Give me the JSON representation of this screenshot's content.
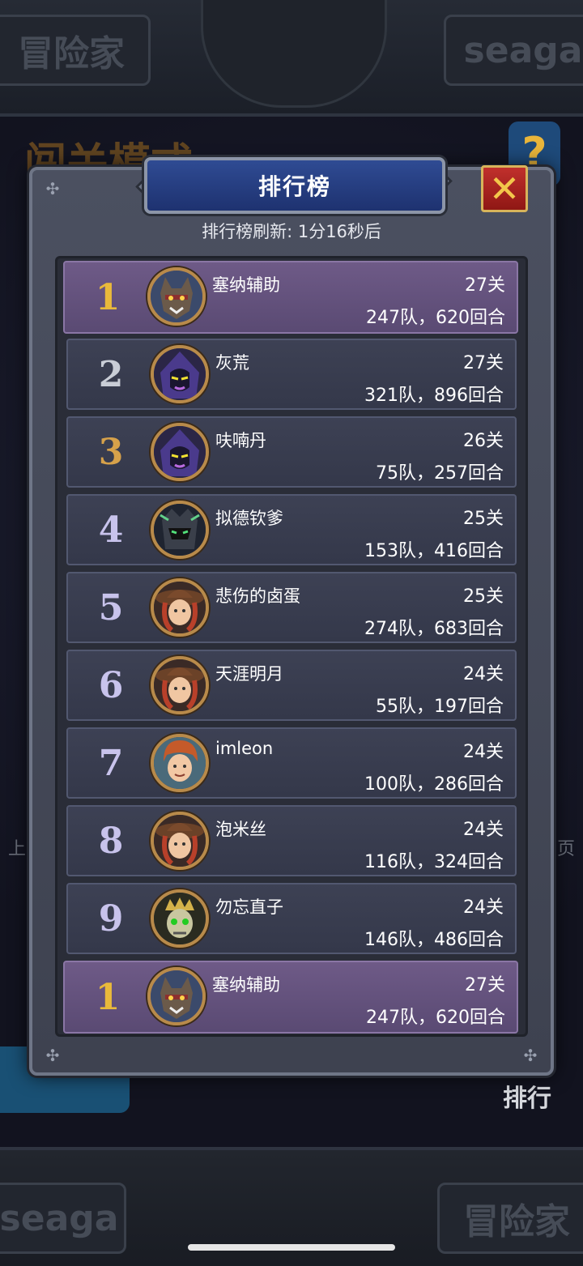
{
  "background": {
    "top_left_plate": "冒险家",
    "top_right_plate": "seaga",
    "mode_title": "闯关模式",
    "help_icon": "question-mark-icon",
    "side_left": "上",
    "side_right": "页",
    "rank_button": "排行",
    "bottom_left_plate": "seaga",
    "bottom_right_plate": "冒险家"
  },
  "dialog": {
    "title": "排行榜",
    "close_icon": "close-x-icon",
    "refresh_text": "排行榜刷新: 1分16秒后"
  },
  "rank_colors": {
    "1": "#e9b93b",
    "2": "#c9cdd6",
    "3": "#d6a14a",
    "other": "#c8c3ec"
  },
  "rows": [
    {
      "rank": "1",
      "name": "塞纳辅助",
      "level": "27关",
      "stats": "247队，620回合",
      "avatar": "werewolf-avatar"
    },
    {
      "rank": "2",
      "name": "灰荒",
      "level": "27关",
      "stats": "321队，896回合",
      "avatar": "hooded-mage-avatar"
    },
    {
      "rank": "3",
      "name": "呋喃丹",
      "level": "26关",
      "stats": "75队，257回合",
      "avatar": "hooded-mage-avatar"
    },
    {
      "rank": "4",
      "name": "拟德钦爹",
      "level": "25关",
      "stats": "153队，416回合",
      "avatar": "dark-knight-avatar"
    },
    {
      "rank": "5",
      "name": "悲伤的卤蛋",
      "level": "25关",
      "stats": "274队，683回合",
      "avatar": "cowgirl-avatar"
    },
    {
      "rank": "6",
      "name": "天涯明月",
      "level": "24关",
      "stats": "55队，197回合",
      "avatar": "cowgirl-avatar"
    },
    {
      "rank": "7",
      "name": "imleon",
      "level": "24关",
      "stats": "100队，286回合",
      "avatar": "red-hair-boy-avatar"
    },
    {
      "rank": "8",
      "name": "泡米丝",
      "level": "24关",
      "stats": "116队，324回合",
      "avatar": "cowgirl-avatar"
    },
    {
      "rank": "9",
      "name": "勿忘直子",
      "level": "24关",
      "stats": "146队，486回合",
      "avatar": "skeleton-king-avatar"
    }
  ],
  "my_row": {
    "rank": "1",
    "name": "塞纳辅助",
    "level": "27关",
    "stats": "247队，620回合",
    "avatar": "werewolf-avatar"
  }
}
